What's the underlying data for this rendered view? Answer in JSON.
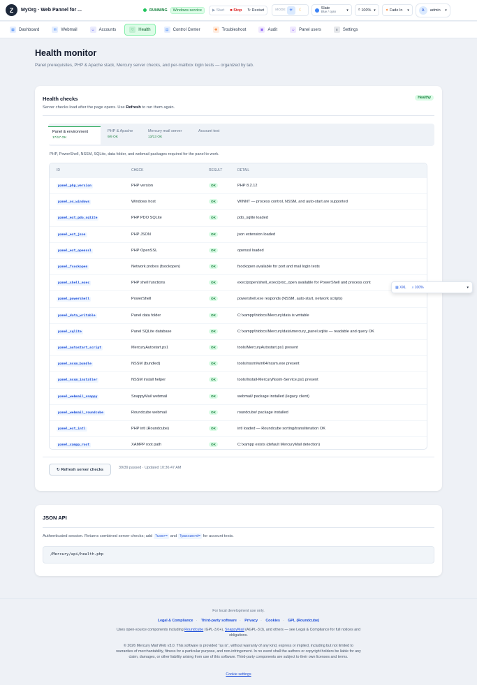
{
  "topbar": {
    "org": "MyOrg · Web Pannel for ...",
    "status": "RUNNING",
    "service_badge": "Windows service",
    "start": "Start",
    "stop": "Stop",
    "restart": "Restart",
    "mode_label": "MODE",
    "theme_name": "Slate",
    "theme_sub": "Blue / cyan",
    "zoom": "100%",
    "transition": "Fade In",
    "user_initial": "A",
    "user": "admin"
  },
  "nav": [
    {
      "label": "Dashboard",
      "icon": "dashboard-icon",
      "glyph": "▦",
      "color": "#3b82f6"
    },
    {
      "label": "Webmail",
      "icon": "mail-icon",
      "glyph": "✉",
      "color": "#3b82f6"
    },
    {
      "label": "Accounts",
      "icon": "accounts-icon",
      "glyph": "☺",
      "color": "#6366f1"
    },
    {
      "label": "Health",
      "icon": "heart-icon",
      "glyph": "♡",
      "color": "#16a34a"
    },
    {
      "label": "Control Center",
      "icon": "server-icon",
      "glyph": "▤",
      "color": "#3b82f6"
    },
    {
      "label": "Troubleshoot",
      "icon": "wrench-icon",
      "glyph": "✚",
      "color": "#f97316"
    },
    {
      "label": "Audit",
      "icon": "clipboard-icon",
      "glyph": "▣",
      "color": "#8b5cf6"
    },
    {
      "label": "Panel users",
      "icon": "users-icon",
      "glyph": "☺",
      "color": "#8b5cf6"
    },
    {
      "label": "Settings",
      "icon": "sliders-icon",
      "glyph": "≡",
      "color": "#475569"
    }
  ],
  "page": {
    "title": "Health monitor",
    "subtitle": "Panel prerequisites, PHP & Apache stack, Mercury server checks, and per-mailbox login tests — organized by tab."
  },
  "health": {
    "title": "Health checks",
    "sub_pre": "Server checks load after the page opens. Use ",
    "sub_bold": "Refresh",
    "sub_post": " to run them again.",
    "badge": "Healthy",
    "tabs": [
      {
        "label": "Panel & environment",
        "count": "17/17 OK"
      },
      {
        "label": "PHP & Apache",
        "count": "9/9 OK"
      },
      {
        "label": "Mercury mail server",
        "count": "13/13 OK"
      },
      {
        "label": "Account test",
        "count": ""
      }
    ],
    "tab_desc": "PHP, PowerShell, NSSM, SQLite, data folder, and webmail packages required for the panel to work.",
    "columns": [
      "ID",
      "CHECK",
      "RESULT",
      "DETAIL"
    ],
    "rows": [
      {
        "id": "panel_php_version",
        "check": "PHP version",
        "result": "OK",
        "detail": "PHP 8.2.12"
      },
      {
        "id": "panel_os_windows",
        "check": "Windows host",
        "result": "OK",
        "detail": "WINNT — process control, NSSM, and auto-start are supported"
      },
      {
        "id": "panel_ext_pdo_sqlite",
        "check": "PHP PDO SQLite",
        "result": "OK",
        "detail": "pdo_sqlite loaded"
      },
      {
        "id": "panel_ext_json",
        "check": "PHP JSON",
        "result": "OK",
        "detail": "json extension loaded"
      },
      {
        "id": "panel_ext_openssl",
        "check": "PHP OpenSSL",
        "result": "OK",
        "detail": "openssl loaded"
      },
      {
        "id": "panel_fsockopen",
        "check": "Network probes (fsockopen)",
        "result": "OK",
        "detail": "fsockopen available for port and mail login tests"
      },
      {
        "id": "panel_shell_exec",
        "check": "PHP shell functions",
        "result": "OK",
        "detail": "exec/popen/shell_exec/proc_open available for PowerShell and process cont"
      },
      {
        "id": "panel_powershell",
        "check": "PowerShell",
        "result": "OK",
        "detail": "powershell.exe responds (NSSM, auto-start, network scripts)"
      },
      {
        "id": "panel_data_writable",
        "check": "Panel data folder",
        "result": "OK",
        "detail": "C:\\xampp\\htdocs\\Mercury\\data is writable"
      },
      {
        "id": "panel_sqlite",
        "check": "Panel SQLite database",
        "result": "OK",
        "detail": "C:\\xampp\\htdocs\\Mercury\\data\\mercury_panel.sqlite — readable and query OK"
      },
      {
        "id": "panel_autostart_script",
        "check": "MercuryAutostart.ps1",
        "result": "OK",
        "detail": "tools/MercuryAutostart.ps1 present"
      },
      {
        "id": "panel_nssm_bundle",
        "check": "NSSM (bundled)",
        "result": "OK",
        "detail": "tools/nssm/win64/nssm.exe present"
      },
      {
        "id": "panel_nssm_installer",
        "check": "NSSM install helper",
        "result": "OK",
        "detail": "tools/Install-MercuryNssm-Service.ps1 present"
      },
      {
        "id": "panel_webmail_snappy",
        "check": "SnappyMail webmail",
        "result": "OK",
        "detail": "webmail/ package installed (legacy client)"
      },
      {
        "id": "panel_webmail_roundcube",
        "check": "Roundcube webmail",
        "result": "OK",
        "detail": "roundcube/ package installed"
      },
      {
        "id": "panel_ext_intl",
        "check": "PHP intl (Roundcube)",
        "result": "OK",
        "detail": "intl loaded — Roundcube sorting/transliteration OK"
      },
      {
        "id": "panel_xampp_root",
        "check": "XAMPP root path",
        "result": "OK",
        "detail": "C:\\xampp exists (default MercuryMail detection)"
      }
    ],
    "refresh": "↻ Refresh server checks",
    "passed": "39/39 passed · Updated 10:36:47 AM"
  },
  "floating": {
    "size": "XXL",
    "zoom": "100%"
  },
  "json_api": {
    "title": "JSON API",
    "desc_pre": "Authenticated session. Returns combined server checks; add",
    "user_param": "?user=",
    "and": "and",
    "pass_param": "?password=",
    "desc_post": "for account tests.",
    "endpoint": "/Mercury/api/health.php"
  },
  "footer": {
    "local": "For local development use only.",
    "links": [
      "Legal & Compliance",
      "Third-party software",
      "Privacy",
      "Cookies",
      "GPL (Roundcube)"
    ],
    "oss_pre": "Uses open-source components including ",
    "roundcube": "Roundcube",
    "rc_lic": " (GPL-3.0+), ",
    "snappy": "SnappyMail",
    "oss_post": " (AGPL-3.0), and others — see Legal & Compliance for full notices and obligations.",
    "copyright": "© 2026 Mercury Mail Web v3.0. This software is provided \"as is\", without warranty of any kind, express or implied, including but not limited to warranties of merchantability, fitness for a particular purpose, and non-infringement. In no event shall the authors or copyright holders be liable for any claim, damages, or other liability arising from use of this software. Third-party components are subject to their own licenses and terms.",
    "cookie": "Cookie settings"
  }
}
